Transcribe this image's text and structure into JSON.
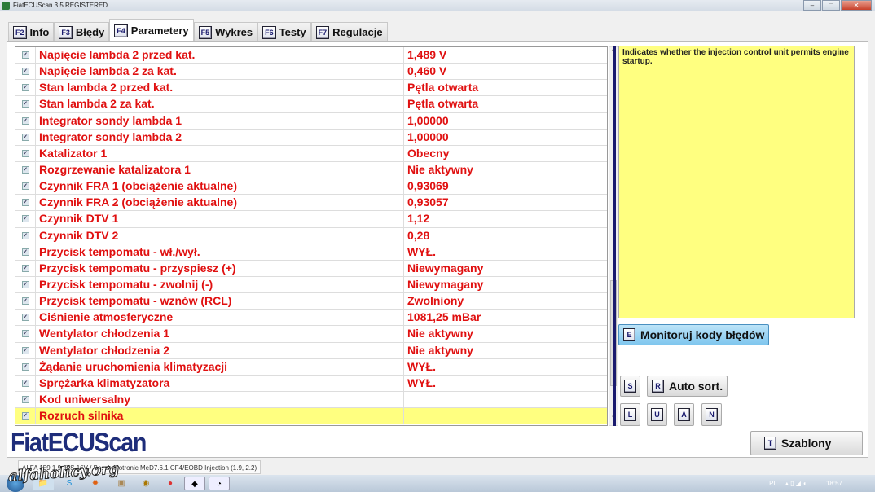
{
  "window": {
    "title": "FiatECUScan 3.5 REGISTERED"
  },
  "tabs": [
    {
      "key": "F2",
      "label": "Info"
    },
    {
      "key": "F3",
      "label": "Błędy"
    },
    {
      "key": "F4",
      "label": "Parametery",
      "active": true
    },
    {
      "key": "F5",
      "label": "Wykres"
    },
    {
      "key": "F6",
      "label": "Testy"
    },
    {
      "key": "F7",
      "label": "Regulacje"
    }
  ],
  "rows": [
    {
      "label": "Napięcie lambda 2 przed kat.",
      "value": "1,489 V"
    },
    {
      "label": "Napięcie lambda 2 za kat.",
      "value": "0,460 V"
    },
    {
      "label": "Stan lambda 2 przed kat.",
      "value": "Pętla otwarta"
    },
    {
      "label": "Stan lambda 2 za kat.",
      "value": "Pętla otwarta"
    },
    {
      "label": "Integrator sondy lambda 1",
      "value": "1,00000"
    },
    {
      "label": "Integrator sondy lambda 2",
      "value": "1,00000"
    },
    {
      "label": "Katalizator 1",
      "value": "Obecny"
    },
    {
      "label": "Rozgrzewanie katalizatora 1",
      "value": "Nie aktywny"
    },
    {
      "label": "Czynnik FRA 1 (obciążenie aktualne)",
      "value": "0,93069"
    },
    {
      "label": "Czynnik FRA 2 (obciążenie aktualne)",
      "value": "0,93057"
    },
    {
      "label": "Czynnik DTV 1",
      "value": "1,12"
    },
    {
      "label": "Czynnik DTV 2",
      "value": "0,28"
    },
    {
      "label": "Przycisk tempomatu - wł./wył.",
      "value": "WYŁ."
    },
    {
      "label": "Przycisk tempomatu - przyspiesz (+)",
      "value": "Niewymagany"
    },
    {
      "label": "Przycisk tempomatu - zwolnij (-)",
      "value": "Niewymagany"
    },
    {
      "label": "Przycisk tempomatu - wznów (RCL)",
      "value": "Zwolniony"
    },
    {
      "label": "Ciśnienie atmosferyczne",
      "value": "1081,25 mBar"
    },
    {
      "label": "Wentylator chłodzenia 1",
      "value": "Nie aktywny"
    },
    {
      "label": "Wentylator chłodzenia 2",
      "value": "Nie aktywny"
    },
    {
      "label": "Żądanie uruchomienia klimatyzacji",
      "value": "WYŁ."
    },
    {
      "label": "Sprężarka klimatyzatora",
      "value": "WYŁ."
    },
    {
      "label": "Kod uniwersalny",
      "value": ""
    },
    {
      "label": "Rozruch silnika",
      "value": "",
      "selected": true
    }
  ],
  "description": "Indicates whether the injection control unit permits engine startup.",
  "buttons": {
    "monitor": {
      "key": "E",
      "label": "Monitoruj kody błędów"
    },
    "s": {
      "key": "S"
    },
    "autosort": {
      "key": "R",
      "label": "Auto sort."
    },
    "l": {
      "key": "L"
    },
    "u": {
      "key": "U"
    },
    "a": {
      "key": "A"
    },
    "n": {
      "key": "N"
    },
    "templates": {
      "key": "T",
      "label": "Szablony"
    }
  },
  "logo": "FiatECUScan",
  "status": "ALFA 159 1.9 JTS 16V / Bosch Motronic MeD7.6.1 CF4/EOBD Injection (1.9, 2.2)",
  "watermark": "alfaholicy.org",
  "tray": {
    "lang": "PL",
    "time": "18:57"
  },
  "colors": {
    "param_text": "#e01010",
    "selected_row": "#ffff80",
    "description_bg": "#ffff80",
    "logo": "#1e2d7a"
  }
}
